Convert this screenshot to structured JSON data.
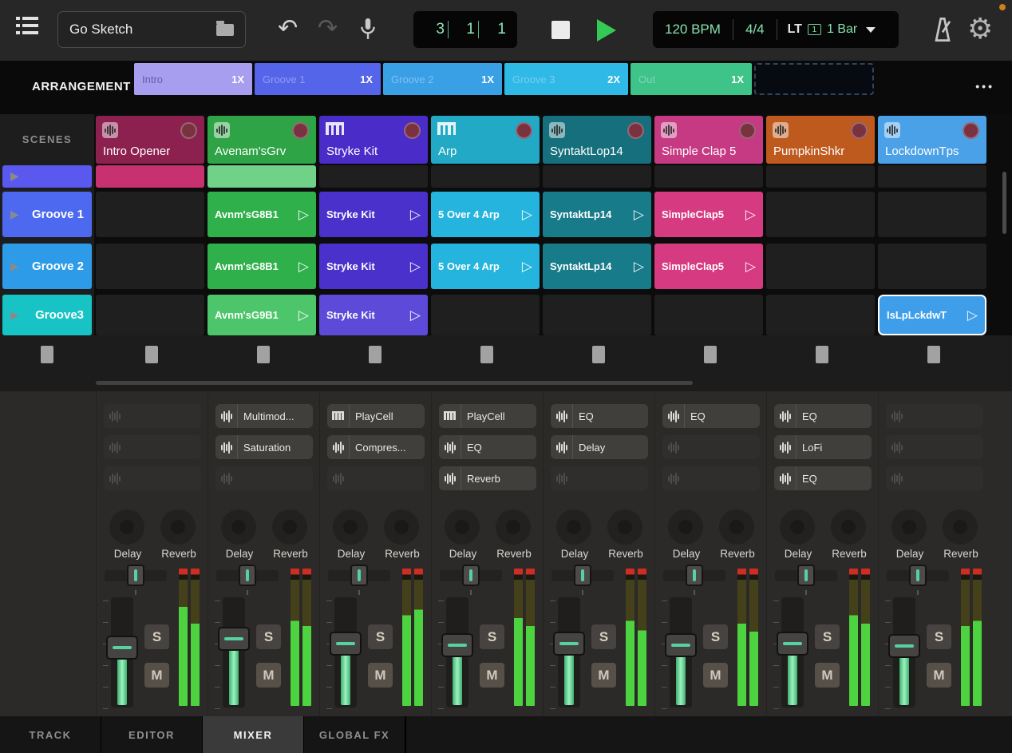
{
  "topbar": {
    "project_name": "Go Sketch",
    "position": [
      "3",
      "1",
      "1"
    ],
    "tempo": "120 BPM",
    "time_signature": "4/4",
    "sync_label": "LT",
    "sync_badge": "1",
    "quantize": "1 Bar"
  },
  "arrangement": {
    "label": "ARRANGEMENT",
    "menu": "•••",
    "sections": [
      {
        "name": "Intro",
        "repeat": "1X",
        "color": "#a89ef0",
        "text_dark": true
      },
      {
        "name": "Groove 1",
        "repeat": "1X",
        "color": "#5565e9"
      },
      {
        "name": "Groove 2",
        "repeat": "1X",
        "color": "#3aa0e6"
      },
      {
        "name": "Groove 3",
        "repeat": "2X",
        "color": "#2fb9e6"
      },
      {
        "name": "Out",
        "repeat": "1X",
        "color": "#3ec488"
      }
    ]
  },
  "scenes": {
    "label": "SCENES",
    "rows": [
      {
        "name": "",
        "color": "#5a58ee",
        "partial": true
      },
      {
        "name": "Groove 1",
        "color": "#4c69ef"
      },
      {
        "name": "Groove 2",
        "color": "#2e9be8"
      },
      {
        "name": "Groove3",
        "color": "#18c3c6"
      }
    ]
  },
  "tracks": [
    {
      "name": "Intro Opener",
      "color": "#8c2150",
      "icon": "sampler",
      "clips": [
        {
          "label": "",
          "color": "#c8316f"
        },
        null,
        null,
        null
      ],
      "devices": [
        null,
        null,
        null
      ],
      "fader": 0.56,
      "meter": [
        0.72,
        0.6
      ]
    },
    {
      "name": "Avenam'sGrv",
      "color": "#2fa446",
      "icon": "sampler",
      "clips": [
        {
          "label": "",
          "color": "#70d287"
        },
        {
          "label": "Avnm'sG8B1",
          "color": "#30b04b"
        },
        {
          "label": "Avnm'sG8B1",
          "color": "#30b04b"
        },
        {
          "label": "Avnm'sG9B1",
          "color": "#4dc56a"
        }
      ],
      "devices": [
        {
          "label": "Multimod...",
          "icon": "wave"
        },
        {
          "label": "Saturation",
          "icon": "wave"
        },
        null
      ],
      "fader": 0.66,
      "meter": [
        0.62,
        0.58
      ]
    },
    {
      "name": "Stryke Kit",
      "color": "#4a2cc9",
      "icon": "piano",
      "clips": [
        null,
        {
          "label": "Stryke Kit",
          "color": "#4a31cb"
        },
        {
          "label": "Stryke Kit",
          "color": "#4a31cb"
        },
        {
          "label": "Stryke Kit",
          "color": "#5e4ad9"
        }
      ],
      "devices": [
        {
          "label": "PlayCell",
          "icon": "piano"
        },
        {
          "label": "Compres...",
          "icon": "wave"
        },
        null
      ],
      "fader": 0.6,
      "meter": [
        0.66,
        0.7
      ]
    },
    {
      "name": "Arp",
      "color": "#21a9c5",
      "icon": "piano",
      "clips": [
        null,
        {
          "label": "5 Over 4 Arp",
          "color": "#25b4dd"
        },
        {
          "label": "5 Over 4 Arp",
          "color": "#25b4dd"
        },
        null
      ],
      "devices": [
        {
          "label": "PlayCell",
          "icon": "piano"
        },
        {
          "label": "EQ",
          "icon": "wave"
        },
        {
          "label": "Reverb",
          "icon": "wave"
        }
      ],
      "fader": 0.58,
      "meter": [
        0.64,
        0.58
      ]
    },
    {
      "name": "SyntaktLop14",
      "color": "#166f7d",
      "icon": "sampler",
      "clips": [
        null,
        {
          "label": "SyntaktLp14",
          "color": "#177b8a"
        },
        {
          "label": "SyntaktLp14",
          "color": "#177b8a"
        },
        null
      ],
      "devices": [
        {
          "label": "EQ",
          "icon": "wave"
        },
        {
          "label": "Delay",
          "icon": "wave"
        },
        null
      ],
      "fader": 0.6,
      "meter": [
        0.62,
        0.55
      ]
    },
    {
      "name": "Simple Clap 5",
      "color": "#c53a83",
      "icon": "sampler",
      "clips": [
        null,
        {
          "label": "SimpleClap5",
          "color": "#d63a80"
        },
        {
          "label": "SimpleClap5",
          "color": "#d63a80"
        },
        null
      ],
      "devices": [
        {
          "label": "EQ",
          "icon": "wave"
        },
        null,
        null
      ],
      "fader": 0.58,
      "meter": [
        0.6,
        0.54
      ]
    },
    {
      "name": "PumpkinShkr",
      "color": "#bf5a1e",
      "icon": "sampler",
      "clips": [
        null,
        null,
        null,
        null
      ],
      "devices": [
        {
          "label": "EQ",
          "icon": "wave"
        },
        {
          "label": "LoFi",
          "icon": "wave"
        },
        {
          "label": "EQ",
          "icon": "wave"
        }
      ],
      "fader": 0.6,
      "meter": [
        0.66,
        0.6
      ]
    },
    {
      "name": "LockdownTps",
      "color": "#4ba1e8",
      "icon": "sampler",
      "clips": [
        null,
        null,
        null,
        {
          "label": "IsLpLckdwT",
          "color": "#3f9ee9",
          "selected": true
        }
      ],
      "devices": [
        null,
        null,
        null
      ],
      "fader": 0.57,
      "meter": [
        0.58,
        0.62
      ]
    }
  ],
  "mixer": {
    "knob_labels": [
      "Delay",
      "Reverb"
    ],
    "solo_label": "S",
    "mute_label": "M"
  },
  "tabs": [
    {
      "label": "TRACK",
      "active": false
    },
    {
      "label": "EDITOR",
      "active": false
    },
    {
      "label": "MIXER",
      "active": true
    },
    {
      "label": "GLOBAL FX",
      "active": false
    }
  ]
}
